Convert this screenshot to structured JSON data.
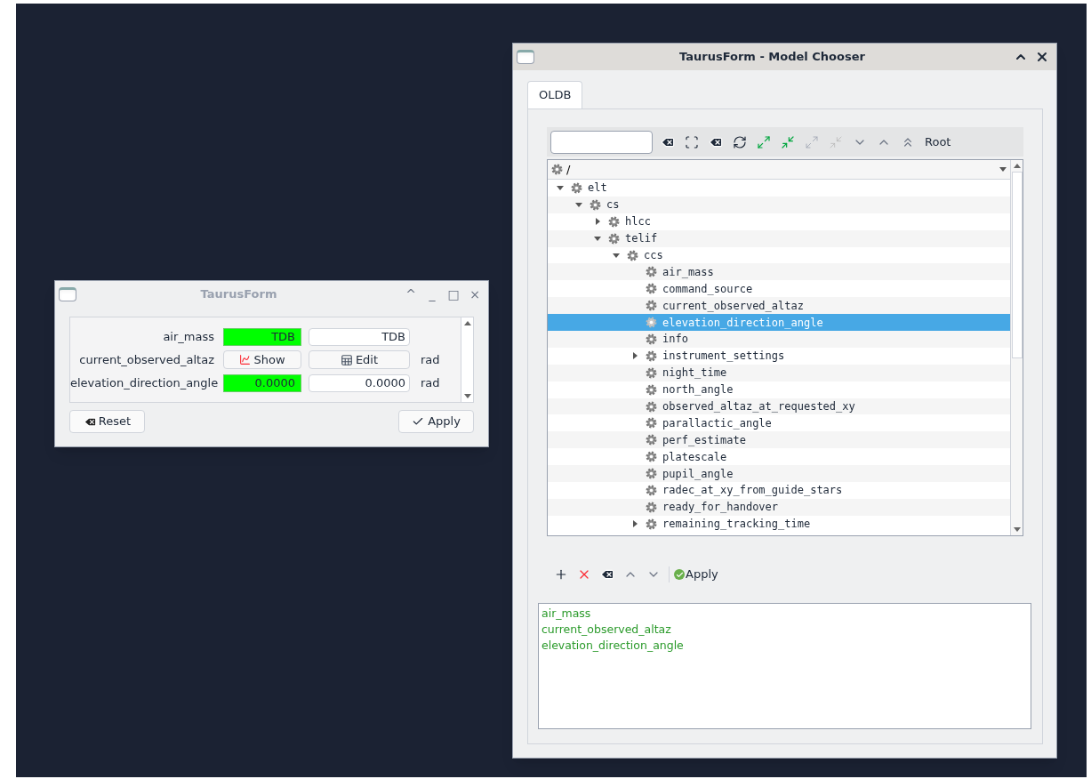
{
  "form_window": {
    "title": "TaurusForm",
    "controls": [
      "^",
      "_",
      "□",
      "×"
    ],
    "rows": [
      {
        "kind": "scalar",
        "label": "air_mass",
        "read": "TDB",
        "write": "TDB"
      },
      {
        "kind": "spectrum",
        "label": "current_observed_altaz",
        "show": "Show",
        "edit": "Edit",
        "unit": "rad"
      },
      {
        "kind": "scalar",
        "label": "elevation_direction_angle",
        "read": "0.0000",
        "write": "0.0000",
        "unit": "rad"
      }
    ],
    "reset_button": "Reset",
    "apply_button": "Apply"
  },
  "chooser_window": {
    "title": "TaurusForm - Model Chooser",
    "tabs": [
      {
        "label": "OLDB",
        "selected": true
      }
    ],
    "toolbar": [
      {
        "kind": "clear",
        "disabled": false
      },
      {
        "kind": "fit",
        "disabled": false
      },
      {
        "kind": "clear",
        "disabled": false
      },
      {
        "kind": "refresh",
        "disabled": false
      },
      {
        "kind": "expand",
        "disabled": false
      },
      {
        "kind": "collapse",
        "disabled": false
      },
      {
        "kind": "expand",
        "disabled": true
      },
      {
        "kind": "collapse",
        "disabled": true
      },
      {
        "kind": "down"
      },
      {
        "kind": "up"
      },
      {
        "kind": "top"
      }
    ],
    "root_button": "Root",
    "path_combo": "/",
    "tree": [
      {
        "label": "elt",
        "expanded": true,
        "selected": false,
        "children": [
          {
            "label": "cs",
            "expanded": true,
            "selected": false,
            "children": [
              {
                "label": "hlcc",
                "expanded": false,
                "selected": false
              },
              {
                "label": "telif",
                "expanded": true,
                "selected": false,
                "children": [
                  {
                    "label": "ccs",
                    "expanded": true,
                    "selected": false,
                    "children": [
                      {
                        "label": "air_mass",
                        "selected": false
                      },
                      {
                        "label": "command_source",
                        "selected": false
                      },
                      {
                        "label": "current_observed_altaz",
                        "selected": false
                      },
                      {
                        "label": "elevation_direction_angle",
                        "selected": true
                      },
                      {
                        "label": "info",
                        "selected": false
                      },
                      {
                        "label": "instrument_settings",
                        "expanded": false,
                        "selected": false
                      },
                      {
                        "label": "night_time",
                        "selected": false
                      },
                      {
                        "label": "north_angle",
                        "selected": false
                      },
                      {
                        "label": "observed_altaz_at_requested_xy",
                        "selected": false
                      },
                      {
                        "label": "parallactic_angle",
                        "selected": false
                      },
                      {
                        "label": "perf_estimate",
                        "selected": false
                      },
                      {
                        "label": "platescale",
                        "selected": false
                      },
                      {
                        "label": "pupil_angle",
                        "selected": false
                      },
                      {
                        "label": "radec_at_xy_from_guide_stars",
                        "selected": false
                      },
                      {
                        "label": "ready_for_handover",
                        "selected": false
                      },
                      {
                        "label": "remaining_tracking_time",
                        "expanded": false,
                        "selected": false
                      }
                    ]
                  }
                ]
              }
            ]
          }
        ]
      }
    ],
    "list_toolbar": [
      {
        "kind": "add",
        "disabled": false
      },
      {
        "kind": "remove",
        "disabled": false
      },
      {
        "kind": "clear",
        "disabled": false
      },
      {
        "kind": "up"
      },
      {
        "kind": "down"
      }
    ],
    "list_apply": "Apply",
    "selected_models": [
      "air_mass",
      "current_observed_altaz",
      "elevation_direction_angle"
    ]
  }
}
